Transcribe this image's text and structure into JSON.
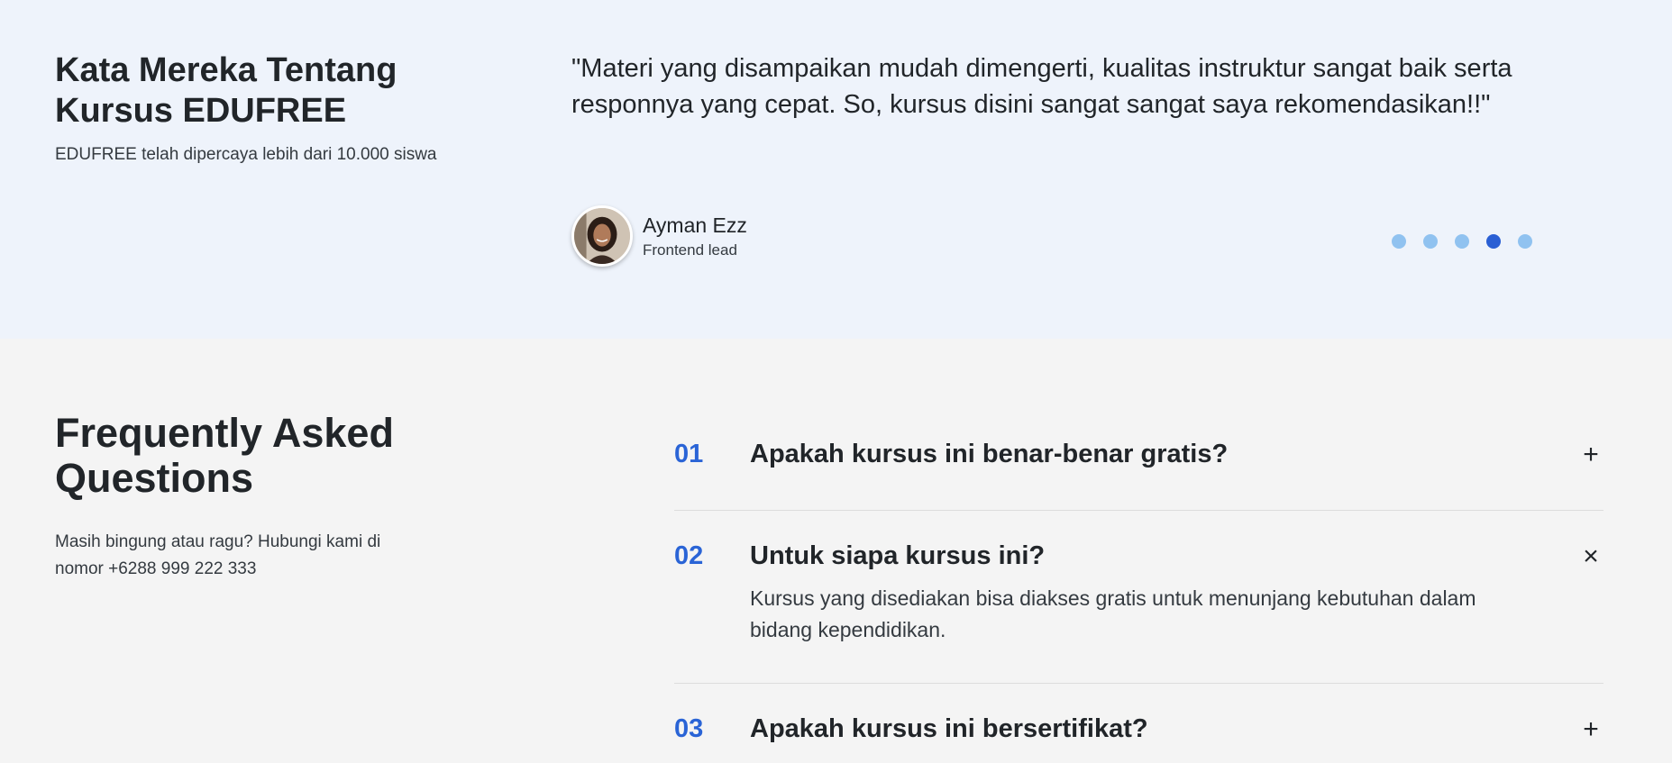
{
  "testimonials": {
    "heading": "Kata Mereka Tentang Kursus EDUFREE",
    "subheading": "EDUFREE telah dipercaya lebih dari 10.000 siswa",
    "quote": "\"Materi yang disampaikan mudah dimengerti, kualitas instruktur sangat baik serta responnya yang cepat. So, kursus disini sangat sangat saya rekomendasikan!!\"",
    "author": {
      "name": "Ayman Ezz",
      "role": "Frontend lead"
    },
    "carousel": {
      "total": 5,
      "active_index": 4
    }
  },
  "faq": {
    "title": "Frequently Asked Questions",
    "subtitle": "Masih bingung atau ragu? Hubungi kami di nomor +6288 999 222 333",
    "items": [
      {
        "number": "01",
        "question": "Apakah kursus ini benar-benar gratis?",
        "toggle": "+",
        "expanded": false
      },
      {
        "number": "02",
        "question": "Untuk siapa kursus ini?",
        "toggle": "×",
        "expanded": true,
        "answer": "Kursus yang disediakan bisa diakses gratis untuk menunjang kebutuhan dalam bidang kependidikan."
      },
      {
        "number": "03",
        "question": "Apakah kursus ini bersertifikat?",
        "toggle": "+",
        "expanded": false
      }
    ]
  },
  "colors": {
    "accent": "#2a64d6",
    "dot_inactive": "#90c2f0",
    "dot_active": "#2a5fd4",
    "testimonial_bg": "#eef3fb",
    "faq_bg": "#f4f4f4"
  }
}
